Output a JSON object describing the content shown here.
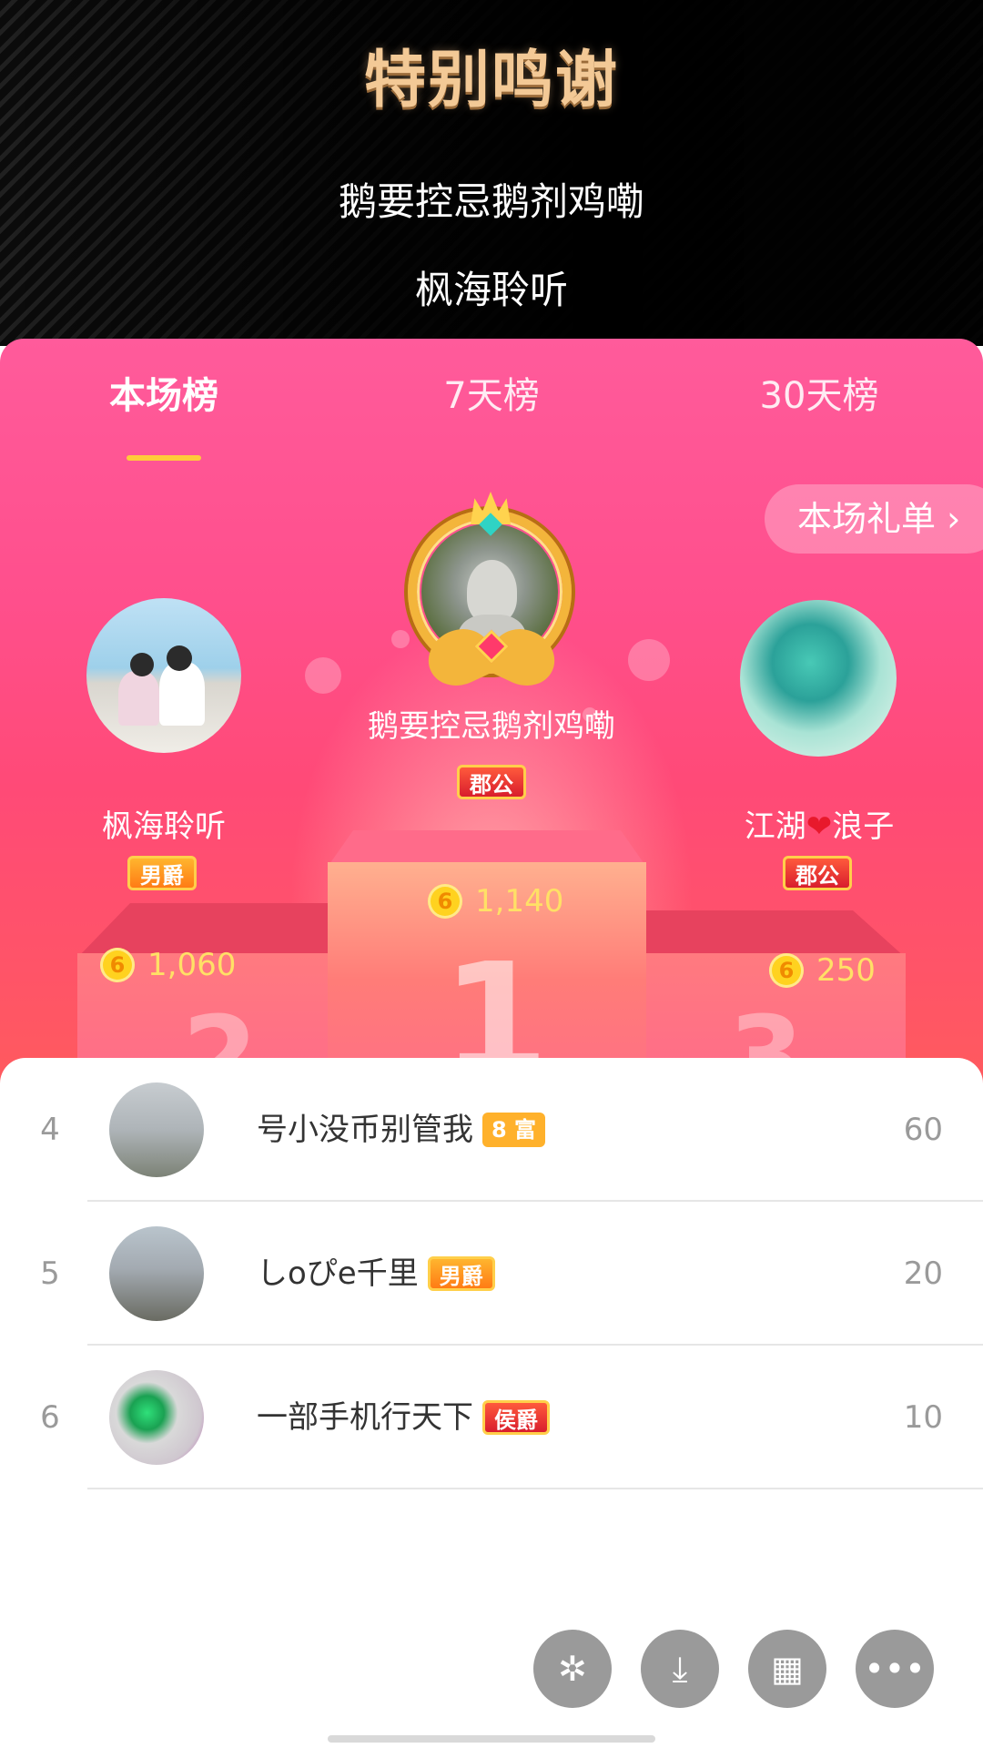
{
  "header": {
    "title": "特别鸣谢",
    "names": [
      "鹅要控忌鹅剂鸡嘞",
      "枫海聆听"
    ]
  },
  "tabs": [
    {
      "label": "本场榜",
      "active": true
    },
    {
      "label": "7天榜",
      "active": false
    },
    {
      "label": "30天榜",
      "active": false
    }
  ],
  "gift_list_button": "本场礼单 ›",
  "podium": {
    "first": {
      "name": "鹅要控忌鹅剂鸡嘞",
      "badge": "郡公",
      "score": "1,140",
      "rank": "1"
    },
    "second": {
      "name": "枫海聆听",
      "badge": "男爵",
      "score": "1,060",
      "rank": "2"
    },
    "third": {
      "name_prefix": "江湖",
      "name_heart": "❤",
      "name_suffix": "浪子",
      "badge": "郡公",
      "score": "250",
      "rank": "3"
    }
  },
  "coin_glyph": "6",
  "list": [
    {
      "rank": "4",
      "name": "号小没币别管我",
      "badge": "8 富",
      "badge_type": "rich",
      "points": "60"
    },
    {
      "rank": "5",
      "name": "しoぴe千里",
      "badge": "男爵",
      "badge_type": "noble-gold",
      "points": "20"
    },
    {
      "rank": "6",
      "name": "一部手机行天下",
      "badge": "侯爵",
      "badge_type": "noble",
      "points": "10"
    }
  ],
  "actions": {
    "effects_icon": "✲",
    "download_icon": "⤓",
    "grid_icon": "▦",
    "more_icon": "•••"
  },
  "colors": {
    "panel_pink": "#ff4f8c",
    "title_gold": "#f3c996",
    "score_yellow": "#ffe066",
    "tab_underline": "#ffcb3a"
  }
}
